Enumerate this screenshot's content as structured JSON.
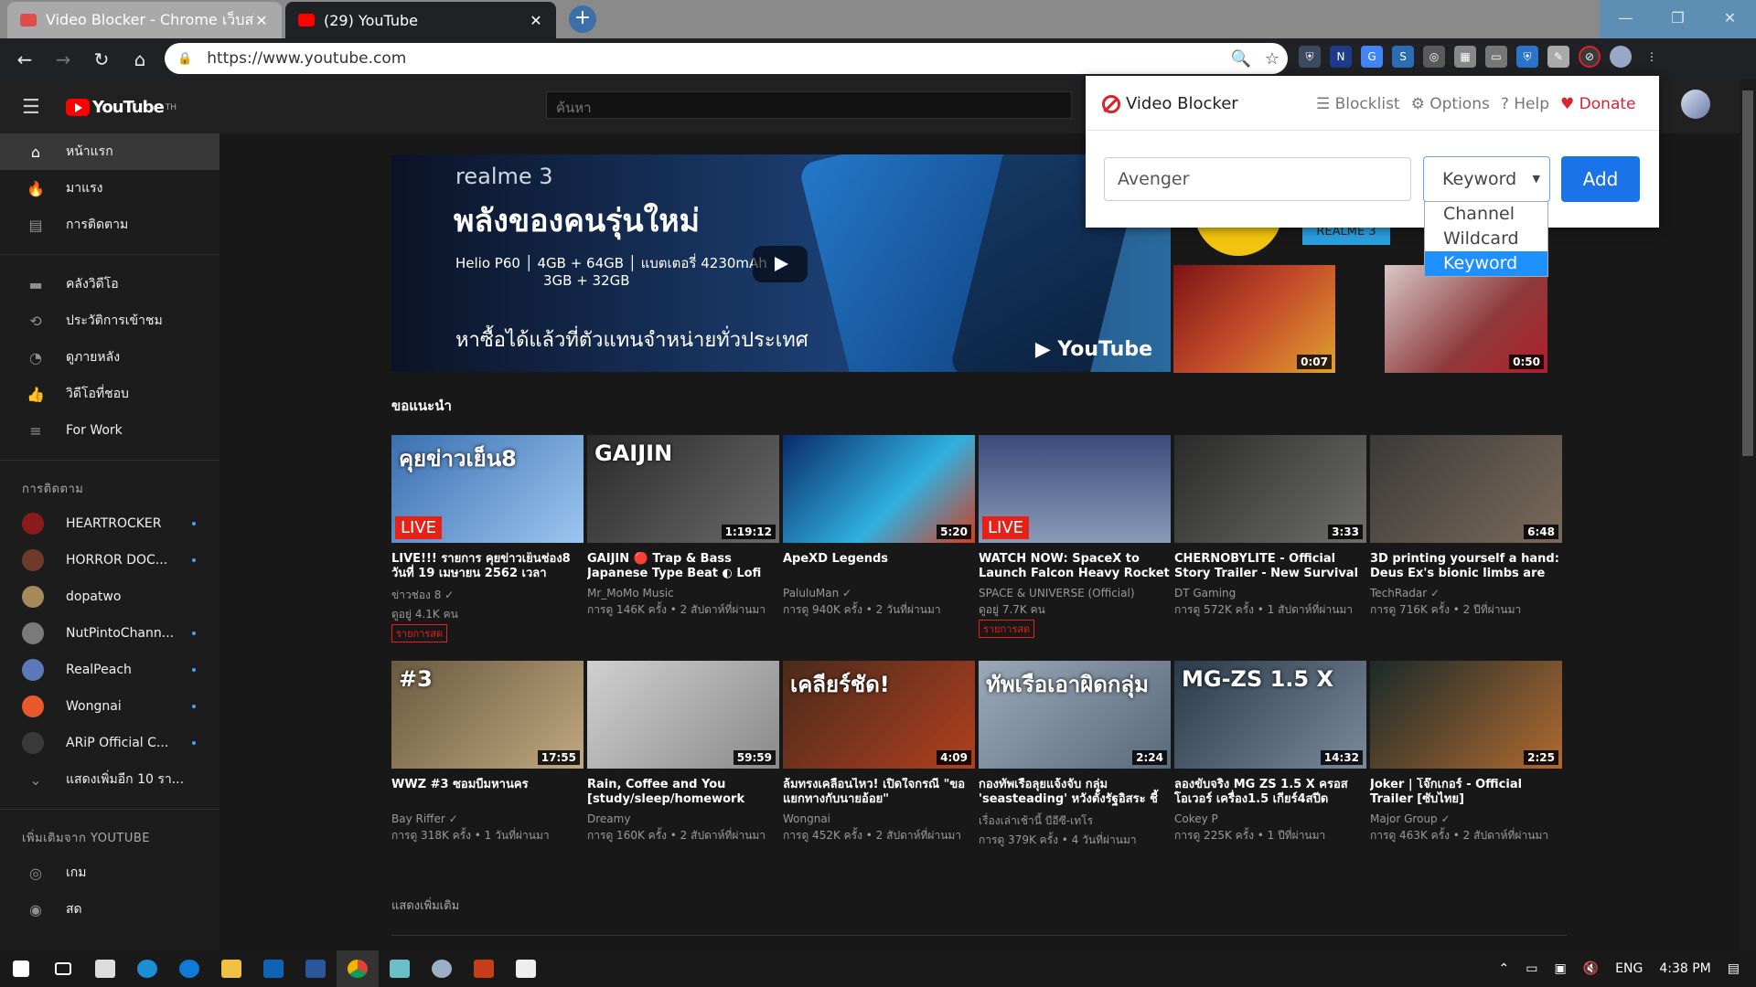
{
  "browser": {
    "tabs": [
      {
        "title": "Video Blocker - Chrome เว็บสโตร์"
      },
      {
        "title": "(29) YouTube"
      }
    ],
    "new_tab": "+",
    "window_controls": {
      "minimize": "—",
      "restore": "❐",
      "close": "✕"
    },
    "url": "https://www.youtube.com"
  },
  "youtube": {
    "logo_text": "YouTube",
    "logo_sup": "TH",
    "search_placeholder": "ค้นหา",
    "sidebar": {
      "main": [
        {
          "label": "หน้าแรก",
          "icon": "home-icon"
        },
        {
          "label": "มาแรง",
          "icon": "flame-icon"
        },
        {
          "label": "การติดตาม",
          "icon": "subscriptions-icon"
        }
      ],
      "library": [
        {
          "label": "คลังวิดีโอ",
          "icon": "folder-icon"
        },
        {
          "label": "ประวัติการเข้าชม",
          "icon": "history-icon"
        },
        {
          "label": "ดูภายหลัง",
          "icon": "clock-icon"
        },
        {
          "label": "วิดีโอที่ชอบ",
          "icon": "thumbs-up-icon"
        },
        {
          "label": "For Work",
          "icon": "playlist-icon"
        }
      ],
      "subs_heading": "การติดตาม",
      "subs": [
        {
          "label": "HEARTROCKER",
          "dot": true
        },
        {
          "label": "HORROR DOC...",
          "dot": true
        },
        {
          "label": "dopatwo",
          "dot": false
        },
        {
          "label": "NutPintoChann...",
          "dot": true
        },
        {
          "label": "RealPeach",
          "dot": true
        },
        {
          "label": "Wongnai",
          "dot": true
        },
        {
          "label": "ARiP Official C...",
          "dot": true
        }
      ],
      "show_more": "แสดงเพิ่มอีก 10 รา...",
      "more_heading": "เพิ่มเติมจาก YOUTUBE",
      "more": [
        {
          "label": "เกม",
          "icon": "gamepad-icon"
        },
        {
          "label": "สด",
          "icon": "live-icon"
        }
      ]
    },
    "banner": {
      "brand": "realme 3",
      "headline": "พลังของคนรุ่นใหม่",
      "spec_line1": "Helio P60 │ 4GB + 64GB │ แบตเตอรี่ 4230mAh",
      "spec_line2": "3GB + 32GB",
      "subline": "หาซื้อได้แล้วที่ตัวแทนจำหน่ายทั่วประเทศ",
      "yt_mark": "▶ YouTube",
      "realme_btn": "REALME 3",
      "side_durations": [
        "0:07",
        "0:50"
      ]
    },
    "section_title": "ขอแนะนำ",
    "videos": [
      {
        "title": "LIVE!!! รายการ คุยข่าวเย็นช่อง8 วันที่ 19 เมษายน 2562 เวลา",
        "channel": "ข่าวช่อง 8 ✓",
        "meta": "ดูอยู่ 4.1K คน",
        "badge": "รายการสด",
        "overlay": "คุยข่าวเย็น8",
        "live_label": "LIVE",
        "duration": ""
      },
      {
        "title": "GAIJIN 🔴 Trap & Bass Japanese Type Beat ◐ Lofi",
        "channel": "Mr_MoMo Music",
        "meta": "การดู 146K ครั้ง • 2 สัปดาห์ที่ผ่านมา",
        "overlay": "GAIJIN",
        "duration": "1:19:12"
      },
      {
        "title": "ApeXD Legends",
        "channel": "PaluluMan ✓",
        "meta": "การดู 940K ครั้ง • 2 วันที่ผ่านมา",
        "overlay": "",
        "duration": "5:20"
      },
      {
        "title": "WATCH NOW: SpaceX to Launch Falcon Heavy Rocket",
        "channel": "SPACE & UNIVERSE (Official)",
        "meta": "ดูอยู่ 7.7K คน",
        "badge": "รายการสด",
        "overlay": "",
        "live_label": "LIVE",
        "duration": ""
      },
      {
        "title": "CHERNOBYLITE - Official Story Trailer - New Survival",
        "channel": "DT Gaming",
        "meta": "การดู 572K ครั้ง • 1 สัปดาห์ที่ผ่านมา",
        "overlay": "",
        "duration": "3:33"
      },
      {
        "title": "3D printing yourself a hand: Deus Ex's bionic limbs are",
        "channel": "TechRadar ✓",
        "meta": "การดู 716K ครั้ง • 2 ปีที่ผ่านมา",
        "overlay": "",
        "duration": "6:48"
      },
      {
        "title": "WWZ #3 ซอมบี้มหานคร",
        "channel": "Bay Riffer ✓",
        "meta": "การดู 318K ครั้ง • 1 วันที่ผ่านมา",
        "overlay": "#3",
        "duration": "17:55"
      },
      {
        "title": "Rain, Coffee and You [study/sleep/homework",
        "channel": "Dreamy",
        "meta": "การดู 160K ครั้ง • 2 สัปดาห์ที่ผ่านมา",
        "overlay": "",
        "duration": "59:59"
      },
      {
        "title": "ล้มทรงเคลื่อนไหว! เปิดใจกรณี \"ขอแยกทางกับนายอ้อย\"",
        "channel": "Wongnai",
        "meta": "การดู 452K ครั้ง • 2 สัปดาห์ที่ผ่านมา",
        "overlay": "เคลียร์ชัด!",
        "duration": "4:09"
      },
      {
        "title": "กองทัพเรือลุยแจ้งจับ กลุ่ม 'seasteading' หวังตั้งรัฐอิสระ ชี้",
        "channel": "เรื่องเล่าเช้านี้ บีอีซี-เทโร",
        "meta": "การดู 379K ครั้ง • 4 วันที่ผ่านมา",
        "overlay": "ทัพเรือเอาผิดกลุ่ม",
        "duration": "2:24"
      },
      {
        "title": "ลองขับจริง MG ZS 1.5 X ครอส โอเวอร์ เครื่อง1.5 เกียร์4สปีด",
        "channel": "Cokey P",
        "meta": "การดู 225K ครั้ง • 1 ปีที่ผ่านมา",
        "overlay": "MG-ZS 1.5 X",
        "duration": "14:32"
      },
      {
        "title": "Joker | โจ๊กเกอร์ - Official Trailer [ซับไทย]",
        "channel": "Major Group ✓",
        "meta": "การดู 463K ครั้ง • 2 สัปดาห์ที่ผ่านมา",
        "overlay": "",
        "duration": "2:25"
      }
    ],
    "show_more": "แสดงเพิ่มเติม"
  },
  "popup": {
    "title": "Video Blocker",
    "links": {
      "blocklist": "☰ Blocklist",
      "options": "⚙ Options",
      "help": "? Help",
      "donate": "♥ Donate"
    },
    "input_value": "Avenger",
    "select_value": "Keyword",
    "select_options": [
      "Channel",
      "Wildcard",
      "Keyword"
    ],
    "add_label": "Add"
  },
  "taskbar": {
    "lang": "ENG",
    "time": "4:38 PM"
  },
  "colors": {
    "yt_red": "#ff0000",
    "accent_blue": "#1a73e8",
    "dropdown_selected": "#1e90ff",
    "blocker_red": "#d9232e"
  }
}
